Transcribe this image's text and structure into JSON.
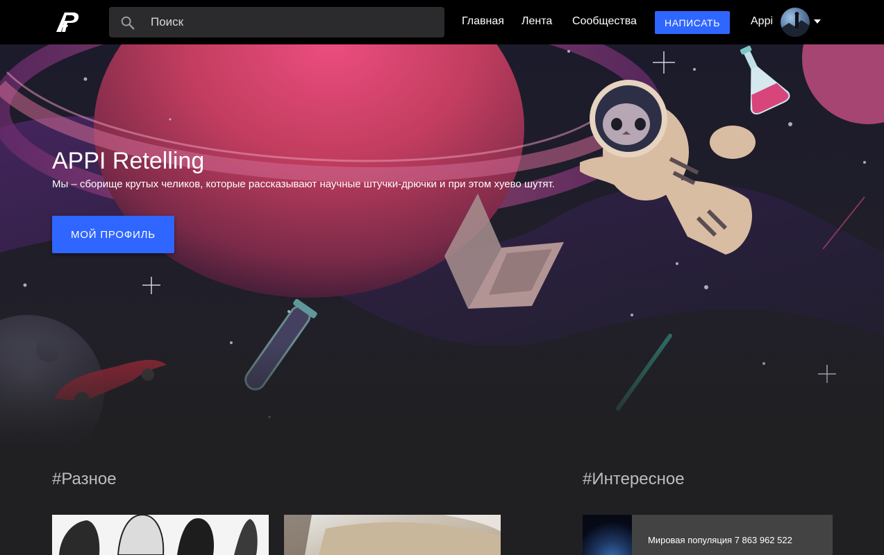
{
  "header": {
    "search_placeholder": "Поиск",
    "nav": [
      {
        "label": "Главная"
      },
      {
        "label": "Лента"
      },
      {
        "label": "Сообщества"
      }
    ],
    "write_label": "НАПИСАТЬ",
    "user_name": "Appi"
  },
  "hero": {
    "title": "APPI Retelling",
    "subtitle": "Мы – сборище крутых челиков, которые рассказывают научные штучки-дрючки и при этом хуево шутят.",
    "profile_button": "МОЙ ПРОФИЛЬ"
  },
  "sections": {
    "misc_title": "#Разное",
    "interesting_title": "#Интересное",
    "interesting_item": "Мировая популяция 7 863 962 522"
  },
  "colors": {
    "accent": "#2f66ff",
    "navbar": "#000000",
    "page_bg": "#202023"
  }
}
